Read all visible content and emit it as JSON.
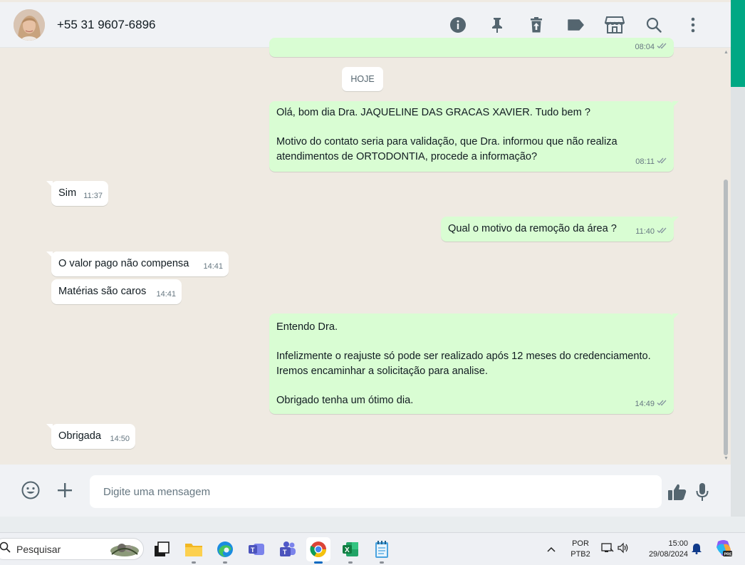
{
  "header": {
    "contact_name": "+55 31 9607-6896",
    "icons": [
      "info-icon",
      "pin-icon",
      "delete-icon",
      "label-icon",
      "store-icon",
      "search-icon",
      "menu-icon"
    ]
  },
  "chat": {
    "date_chip": "HOJE",
    "prev_time": "08:04",
    "messages": [
      {
        "dir": "out",
        "text": "Olá, bom dia Dra. JAQUELINE DAS GRACAS XAVIER. Tudo bem ?\n\nMotivo do contato seria para validação, que Dra. informou que não realiza atendimentos de ORTODONTIA, procede a informação?",
        "time": "08:11"
      },
      {
        "dir": "in",
        "text": "Sim",
        "time": "11:37"
      },
      {
        "dir": "out",
        "text": "Qual o motivo da remoção da área ?",
        "time": "11:40"
      },
      {
        "dir": "in",
        "text": "O valor pago não compensa",
        "time": "14:41"
      },
      {
        "dir": "in",
        "text": "Matérias são caros",
        "time": "14:41"
      },
      {
        "dir": "out",
        "text": "Entendo Dra.\n\nInfelizmente o reajuste só pode ser realizado após 12 meses do credenciamento. Iremos encaminhar a solicitação para analise.\n\nObrigado tenha um ótimo dia.",
        "time": "14:49"
      },
      {
        "dir": "in",
        "text": "Obrigada",
        "time": "14:50"
      }
    ]
  },
  "composer": {
    "placeholder": "Digite uma mensagem"
  },
  "taskbar": {
    "search_label": "Pesquisar",
    "lang_line1": "POR",
    "lang_line2": "PTB2",
    "time": "15:00",
    "date": "29/08/2024"
  },
  "colors": {
    "accent": "#00a884",
    "outgoing_bubble": "#d9fdd3",
    "incoming_bubble": "#ffffff",
    "chat_bg": "#efeae2",
    "read_ticks": "#8696a0"
  }
}
